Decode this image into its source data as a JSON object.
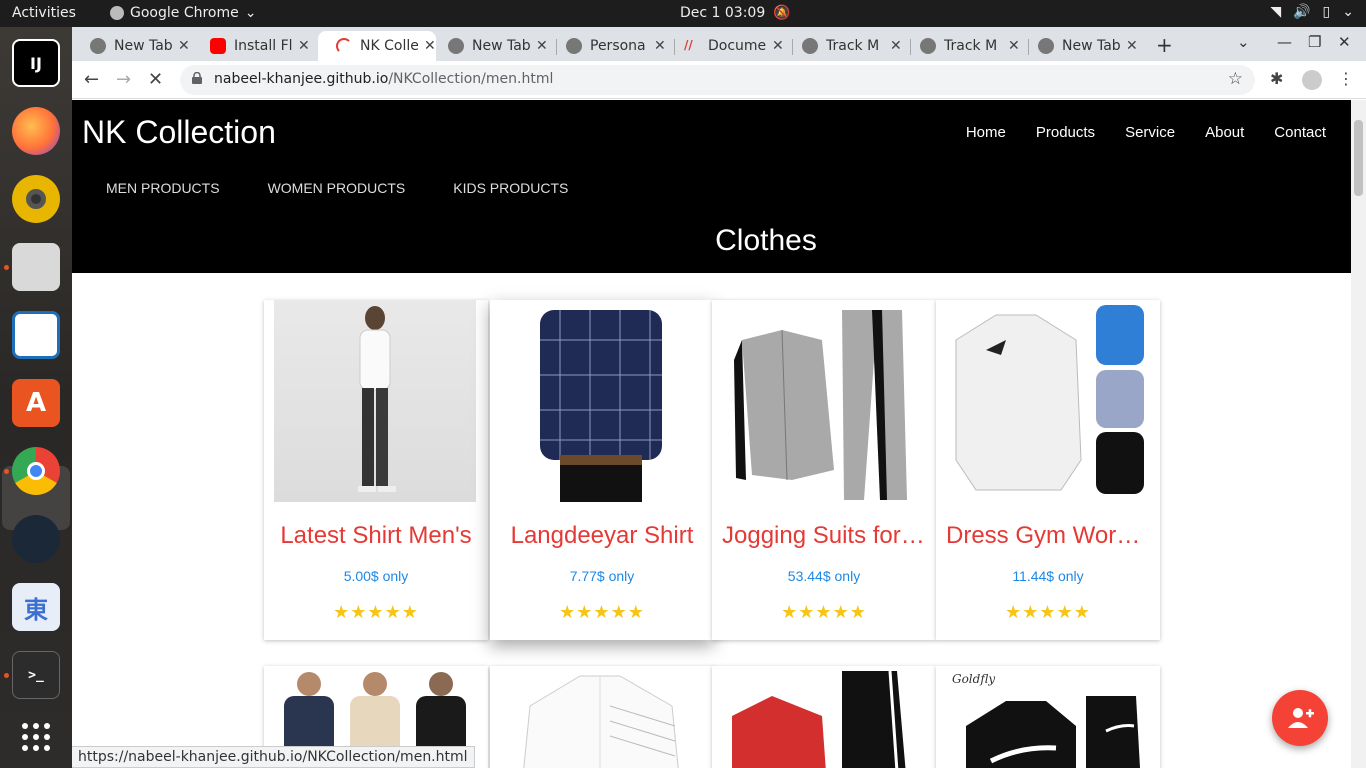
{
  "topbar": {
    "activities": "Activities",
    "app_name": "Google Chrome",
    "clock": "Dec 1  03:09"
  },
  "dock": {
    "items": [
      {
        "name": "intellij",
        "label": "IJ",
        "color": "#000000"
      },
      {
        "name": "firefox",
        "label": "",
        "color": "#ff7139"
      },
      {
        "name": "rhythmbox",
        "label": "",
        "color": "#e8b500"
      },
      {
        "name": "files",
        "label": "",
        "color": "#d9d9d9"
      },
      {
        "name": "libreoffice-writer",
        "label": "",
        "color": "#1e6fb8"
      },
      {
        "name": "ubuntu-software",
        "label": "A",
        "color": "#e95420"
      },
      {
        "name": "chrome",
        "label": "",
        "color": "#4285f4"
      },
      {
        "name": "steam",
        "label": "",
        "color": "#1b2838"
      },
      {
        "name": "anki",
        "label": "東",
        "color": "#e8eef7"
      },
      {
        "name": "terminal",
        "label": ">_",
        "color": "#2c2c2c"
      },
      {
        "name": "show-apps",
        "label": "",
        "color": "transparent"
      }
    ]
  },
  "browser": {
    "tabs": [
      {
        "title": "New Tab",
        "icon": "chrome-icon"
      },
      {
        "title": "Install Fl",
        "icon": "youtube-icon"
      },
      {
        "title": "NK Colle",
        "icon": "loading-icon",
        "active": true
      },
      {
        "title": "New Tab",
        "icon": "chrome-icon"
      },
      {
        "title": "Persona",
        "icon": "chrome-icon"
      },
      {
        "title": "Docume",
        "icon": "doc-icon"
      },
      {
        "title": "Track M",
        "icon": "chrome-icon"
      },
      {
        "title": "Track M",
        "icon": "chrome-icon"
      },
      {
        "title": "New Tab",
        "icon": "chrome-icon"
      }
    ],
    "url_host": "nabeel-khanjee.github.io",
    "url_path": "/NKCollection/men.html",
    "status_url": "https://nabeel-khanjee.github.io/NKCollection/men.html"
  },
  "site": {
    "brand": "NK Collection",
    "nav": [
      "Home",
      "Products",
      "Service",
      "About",
      "Contact"
    ],
    "subnav": [
      "MEN PRODUCTS",
      "WOMEN PRODUCTS",
      "KIDS PRODUCTS"
    ],
    "title": "Clothes",
    "products": [
      {
        "name": "Latest Shirt Men's",
        "price": "5.00$ only",
        "stars": "★★★★★"
      },
      {
        "name": "Langdeeyar Shirt",
        "price": "7.77$ only",
        "stars": "★★★★★"
      },
      {
        "name": "Jogging Suits for Men",
        "price": "53.44$ only",
        "stars": "★★★★★"
      },
      {
        "name": "Dress Gym Workout",
        "price": "11.44$ only",
        "stars": "★★★★★"
      }
    ],
    "second_row_brand": "Goldfly"
  },
  "colors": {
    "product_name": "#e53935",
    "price": "#1e88e5",
    "star": "#f5c518",
    "fab": "#f44336"
  }
}
